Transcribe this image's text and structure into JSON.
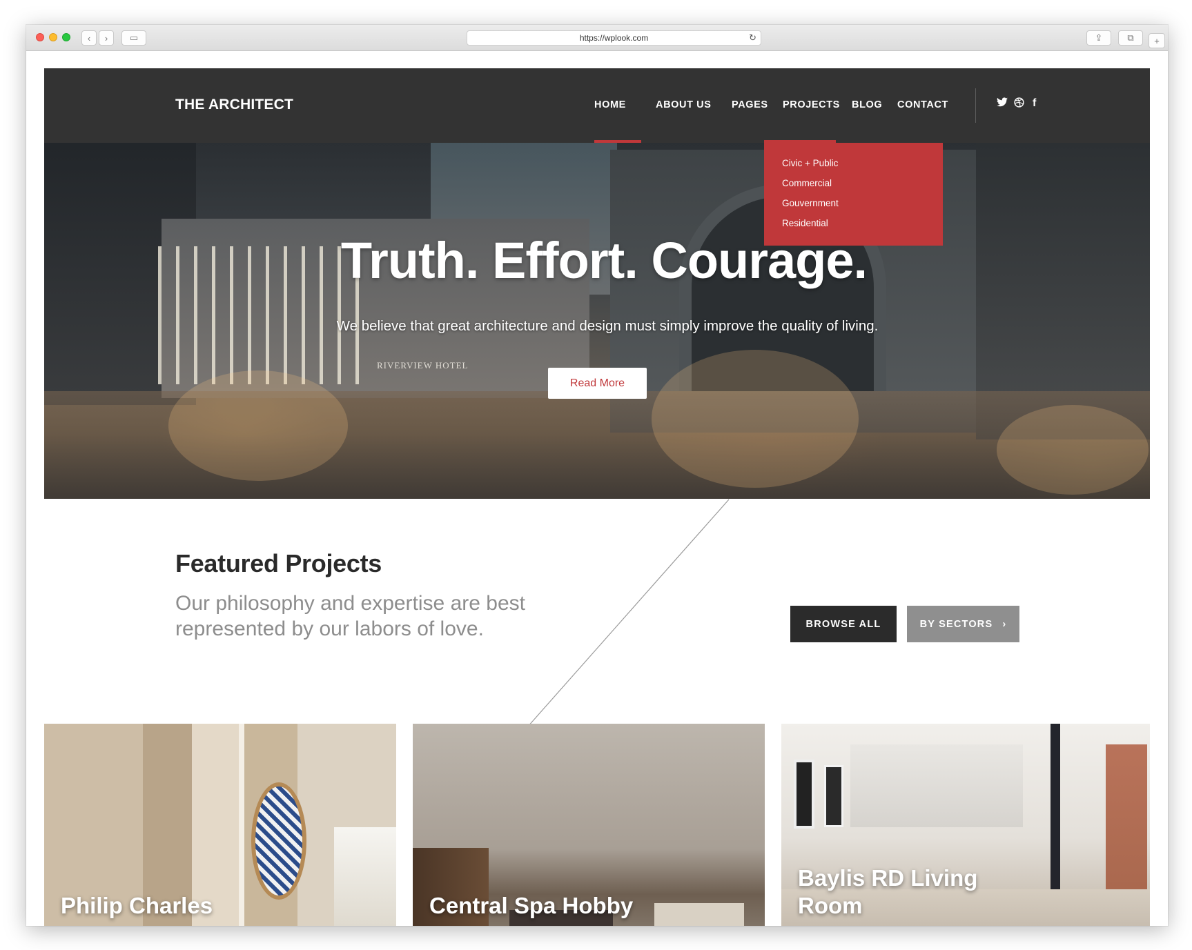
{
  "browser": {
    "url": "https://wplook.com"
  },
  "site": {
    "brand": "THE ARCHITECT",
    "nav": [
      "HOME",
      "ABOUT US",
      "PAGES",
      "PROJECTS",
      "BLOG",
      "CONTACT"
    ],
    "social_icons": [
      "twitter-icon",
      "dribbble-icon",
      "facebook-icon"
    ],
    "dropdown": [
      "Civic + Public",
      "Commercial",
      "Gouvernment",
      "Residential"
    ]
  },
  "hero": {
    "title": "Truth. Effort. Courage.",
    "subtitle": "We believe that great architecture and design must simply improve the quality of living.",
    "button": "Read More",
    "sign_text": "RIVERVIEW HOTEL"
  },
  "featured": {
    "title": "Featured Projects",
    "description": "Our philosophy and expertise are best represented by our labors of love.",
    "browse_all": "BROWSE ALL",
    "by_sectors": "BY SECTORS",
    "projects": [
      {
        "title": "Philip Charles"
      },
      {
        "title": "Central Spa Hobby"
      },
      {
        "title": "Baylis RD Living Room"
      }
    ]
  },
  "colors": {
    "accent": "#c0383a",
    "navbar": "#333333",
    "secondary_button": "#8f8f8f"
  }
}
